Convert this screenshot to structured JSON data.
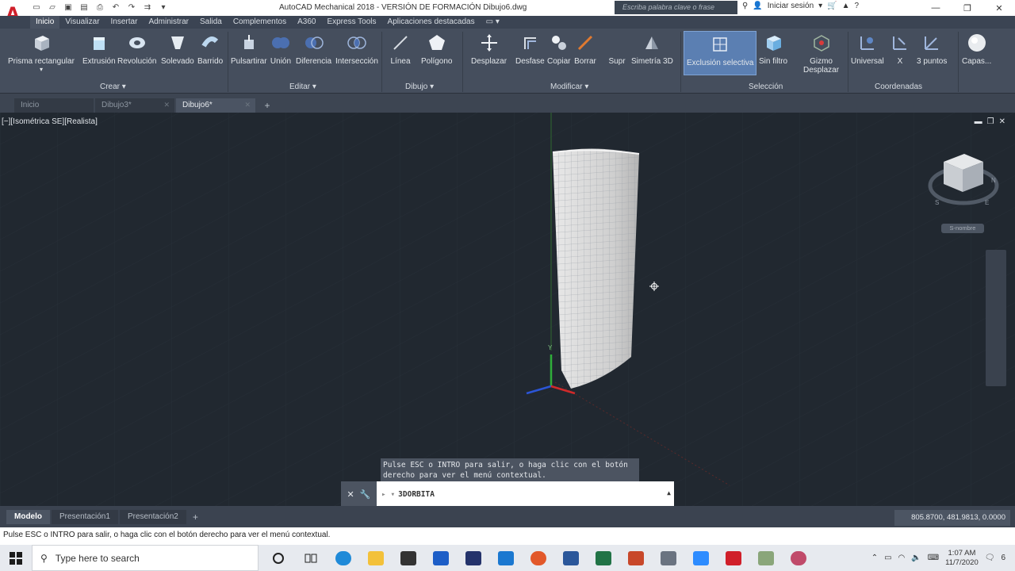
{
  "titlebar": {
    "app_letter": "A",
    "title": "AutoCAD Mechanical 2018 - VERSIÓN DE FORMACIÓN    Dibujo6.dwg",
    "search_placeholder": "Escriba palabra clave o frase",
    "signin": "Iniciar sesión"
  },
  "ribbon_tabs": [
    {
      "label": "Inicio",
      "active": true
    },
    {
      "label": "Visualizar"
    },
    {
      "label": "Insertar"
    },
    {
      "label": "Administrar"
    },
    {
      "label": "Salida"
    },
    {
      "label": "Complementos"
    },
    {
      "label": "A360"
    },
    {
      "label": "Express Tools"
    },
    {
      "label": "Aplicaciones destacadas"
    }
  ],
  "ribbon": {
    "tools": {
      "prisma": "Prisma rectangular",
      "extrusion": "Extrusión",
      "revolucion": "Revolución",
      "solevado": "Solevado",
      "barrido": "Barrido",
      "pulsartirar": "Pulsartirar",
      "union": "Unión",
      "diferencia": "Diferencia",
      "interseccion": "Intersección",
      "linea": "Línea",
      "poligono": "Polígono",
      "desplazar": "Desplazar",
      "desfase": "Desfase",
      "copiar": "Copiar",
      "borrar": "Borrar",
      "supr": "Supr",
      "simetria": "Simetría 3D",
      "exclusion": "Exclusión selectiva",
      "sinfiltro": "Sin filtro",
      "gizmo1": "Gizmo",
      "gizmo2": "Desplazar",
      "universal": "Universal",
      "x": "X",
      "tres_puntos": "3 puntos",
      "capas": "Capas..."
    },
    "panels": {
      "crear": "Crear ▾",
      "editar": "Editar ▾",
      "dibujo": "Dibujo ▾",
      "modificar": "Modificar ▾",
      "seleccion": "Selección",
      "coordenadas": "Coordenadas"
    }
  },
  "file_tabs": [
    {
      "label": "Inicio"
    },
    {
      "label": "Dibujo3*"
    },
    {
      "label": "Dibujo6*",
      "active": true
    }
  ],
  "viewport": {
    "label": "[−][Isométrica SE][Realista]",
    "unnamed": "S-nombre",
    "tooltip_line1": "Pulse ESC o INTRO para salir, o haga clic con el botón",
    "tooltip_line2": "derecho para ver el menú contextual.",
    "command": "3DORBITA",
    "viewcube_n": "N",
    "viewcube_s": "S",
    "viewcube_e": "E",
    "axis_y": "Y"
  },
  "layout_tabs": [
    {
      "label": "Modelo",
      "active": true
    },
    {
      "label": "Presentación1"
    },
    {
      "label": "Presentación2"
    }
  ],
  "coords": "805.8700, 481.9813, 0.0000",
  "statusbar": "Pulse ESC o INTRO para salir, o haga clic con el botón derecho para ver el menú contextual.",
  "taskbar": {
    "search": "Type here to search",
    "time": "1:07 AM",
    "date": "11/7/2020",
    "notif_count": "6"
  },
  "colors": {
    "accent_red": "#d01f2a",
    "ribbon": "#454e5d",
    "viewport": "#212830",
    "selected": "#5b7fb2"
  }
}
